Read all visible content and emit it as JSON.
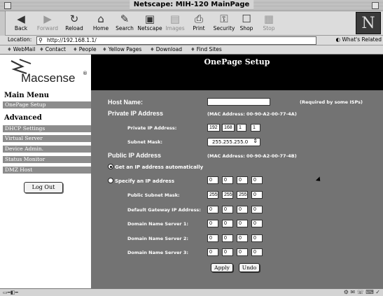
{
  "window": {
    "title": "Netscape: MIH-120 MainPage"
  },
  "toolbar": {
    "buttons": [
      {
        "label": "Back",
        "icon": "back-arrow-icon"
      },
      {
        "label": "Forward",
        "icon": "forward-arrow-icon"
      },
      {
        "label": "Reload",
        "icon": "reload-icon"
      },
      {
        "label": "Home",
        "icon": "home-icon"
      },
      {
        "label": "Search",
        "icon": "search-icon"
      },
      {
        "label": "Netscape",
        "icon": "netscape-icon"
      },
      {
        "label": "Images",
        "icon": "images-icon"
      },
      {
        "label": "Print",
        "icon": "print-icon"
      },
      {
        "label": "Security",
        "icon": "security-icon"
      },
      {
        "label": "Shop",
        "icon": "shop-icon"
      },
      {
        "label": "Stop",
        "icon": "stop-icon"
      }
    ],
    "logo": "N"
  },
  "location": {
    "label": "Location:",
    "url": "http://192.168.1.1/",
    "related": "What's Related"
  },
  "personal_toolbar": {
    "items": [
      "WebMail",
      "Contact",
      "People",
      "Yellow Pages",
      "Download",
      "Find Sites"
    ]
  },
  "sidebar": {
    "brand": "acsense",
    "brand_mark": "®",
    "main_menu_title": "Main Menu",
    "main_items": [
      "OnePage Setup"
    ],
    "advanced_title": "Advanced",
    "advanced_items": [
      "DHCP Settings",
      "Virtual Server",
      "Device Admin.",
      "Status Monitor",
      "DMZ Host"
    ],
    "logout_label": "Log Out"
  },
  "main": {
    "heading": "OnePage Setup",
    "host_name": {
      "label": "Host Name:",
      "value": "",
      "note": "(Required by some ISPs)"
    },
    "private_ip": {
      "section_label": "Private IP Address",
      "mac": "(MAC Address: 00-90-A2-00-77-4A)",
      "ip_label": "Private IP Address:",
      "ip": [
        "192",
        "168",
        "1",
        "1"
      ],
      "mask_label": "Subnet Mask:",
      "mask_value": "255.255.255.0"
    },
    "public_ip": {
      "section_label": "Public IP Address",
      "mac": "(MAC Address: 00-90-A2-00-77-4B)",
      "auto_label": "Get an IP address automatically",
      "specify_label": "Specify an IP address",
      "specify_ip": [
        "0",
        "0",
        "0",
        "0"
      ],
      "mask_label": "Public Subnet Mask:",
      "mask": [
        "255",
        "255",
        "255",
        "0"
      ],
      "gateway_label": "Default Gateway IP Address:",
      "gateway": [
        "0",
        "0",
        "0",
        "0"
      ],
      "dns1_label": "Domain Name Server 1:",
      "dns1": [
        "0",
        "0",
        "0",
        "0"
      ],
      "dns2_label": "Domain Name Server 2:",
      "dns2": [
        "0",
        "0",
        "0",
        "0"
      ],
      "dns3_label": "Domain Name Server 3:",
      "dns3": [
        "0",
        "0",
        "0",
        "0"
      ],
      "selected": "auto"
    },
    "apply_label": "Apply",
    "undo_label": "Undo"
  }
}
